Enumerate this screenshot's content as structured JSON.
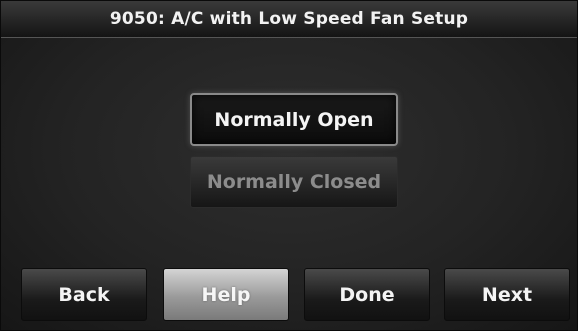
{
  "title": "9050: A/C with Low Speed Fan Setup",
  "options": {
    "selected": "Normally Open",
    "unselected": "Normally Closed"
  },
  "nav": {
    "back": "Back",
    "help": "Help",
    "done": "Done",
    "next": "Next"
  },
  "colors": {
    "background": "#232323",
    "text": "#f4f4f4",
    "disabled_text": "#8c8c8c",
    "help_button": "#b8b8b8"
  }
}
